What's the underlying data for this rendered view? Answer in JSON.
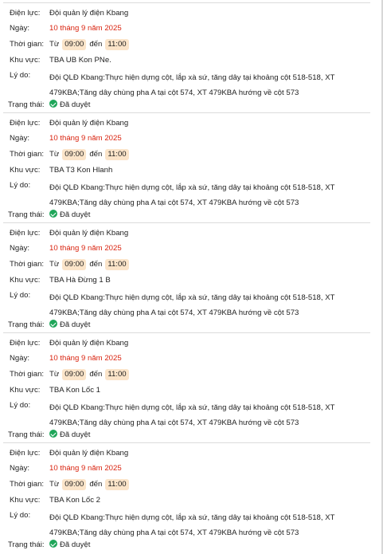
{
  "labels": {
    "unit": "Điện lực:",
    "date": "Ngày:",
    "time": "Thời gian:",
    "area": "Khu vực:",
    "reason": "Lý do:",
    "status": "Trạng thái:",
    "from": "Từ",
    "to": "đến"
  },
  "cards": [
    {
      "unit": "Đội quản lý điện Kbang",
      "date": "10 tháng 9 năm 2025",
      "start": "09:00",
      "end": "11:00",
      "area": "TBA UB Kon PNe.",
      "reason_line1": "Đội QLĐ Kbang:Thực hiện dựng cột, lắp xà sứ, tăng dây tại khoảng cột 518-518, XT",
      "reason_line2": "479KBA;Tăng dây chùng pha A tại cột 574, XT 479KBA hướng về cột 573",
      "status": "Đã duyệt"
    },
    {
      "unit": "Đội quản lý điện Kbang",
      "date": "10 tháng 9 năm 2025",
      "start": "09:00",
      "end": "11:00",
      "area": "TBA T3 Kon Hlanh",
      "reason_line1": "Đội QLĐ Kbang:Thực hiện dựng cột, lắp xà sứ, tăng dây tại khoảng cột 518-518, XT",
      "reason_line2": "479KBA;Tăng dây chùng pha A tại cột 574, XT 479KBA hướng về cột 573",
      "status": "Đã duyệt"
    },
    {
      "unit": "Đội quản lý điện Kbang",
      "date": "10 tháng 9 năm 2025",
      "start": "09:00",
      "end": "11:00",
      "area": "TBA Hà Đừng 1 B",
      "reason_line1": "Đội QLĐ Kbang:Thực hiện dựng cột, lắp xà sứ, tăng dây tại khoảng cột 518-518, XT",
      "reason_line2": "479KBA;Tăng dây chùng pha A tại cột 574, XT 479KBA hướng về cột 573",
      "status": "Đã duyệt"
    },
    {
      "unit": "Đội quản lý điện Kbang",
      "date": "10 tháng 9 năm 2025",
      "start": "09:00",
      "end": "11:00",
      "area": "TBA Kon Lốc 1",
      "reason_line1": "Đội QLĐ Kbang:Thực hiện dựng cột, lắp xà sứ, tăng dây tại khoảng cột 518-518, XT",
      "reason_line2": "479KBA;Tăng dây chùng pha A tại cột 574, XT 479KBA hướng về cột 573",
      "status": "Đã duyệt"
    },
    {
      "unit": "Đội quản lý điện Kbang",
      "date": "10 tháng 9 năm 2025",
      "start": "09:00",
      "end": "11:00",
      "area": "TBA Kon Lốc 2",
      "reason_line1": "Đội QLĐ Kbang:Thực hiện dựng cột, lắp xà sứ, tăng dây tại khoảng cột 518-518, XT",
      "reason_line2": "479KBA;Tăng dây chùng pha A tại cột 574, XT 479KBA hướng về cột 573",
      "status": "Đã duyệt"
    }
  ],
  "status_icon": "check-circle-icon",
  "colors": {
    "date": "#d9230f",
    "time_chip": "#fbe4c9",
    "status_icon": "#1fa65a",
    "divider": "#dcdcdc"
  }
}
